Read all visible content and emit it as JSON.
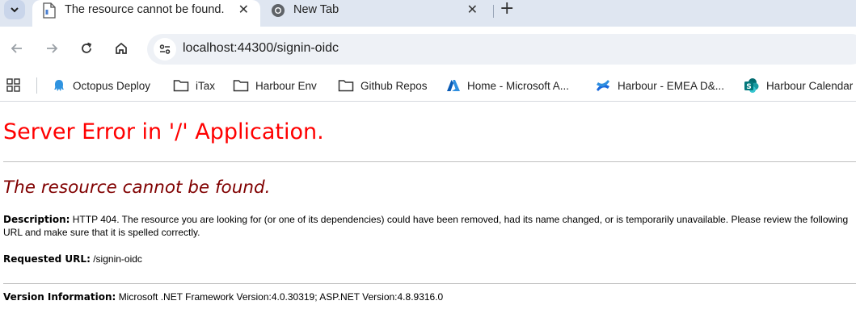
{
  "tabs": [
    {
      "title": "The resource cannot be found.",
      "active": true
    },
    {
      "title": "New Tab",
      "active": false
    }
  ],
  "newtab_label": "+",
  "close_glyph": "✕",
  "omnibox": {
    "url": "localhost:44300/signin-oidc"
  },
  "bookmarks": [
    {
      "label": "Octopus Deploy",
      "icon": "octopus-icon"
    },
    {
      "label": "iTax",
      "icon": "folder-icon"
    },
    {
      "label": "Harbour Env",
      "icon": "folder-icon"
    },
    {
      "label": "Github Repos",
      "icon": "folder-icon"
    },
    {
      "label": "Home - Microsoft A...",
      "icon": "azure-icon"
    },
    {
      "label": "Harbour - EMEA D&...",
      "icon": "confluence-icon"
    },
    {
      "label": "Harbour Calendar",
      "icon": "sharepoint-icon"
    }
  ],
  "error": {
    "heading": "Server Error in '/' Application.",
    "subheading": "The resource cannot be found.",
    "description_label": "Description:",
    "description_text": "HTTP 404. The resource you are looking for (or one of its dependencies) could have been removed, had its name changed, or is temporarily unavailable.  Please review the following URL and make sure that it is spelled correctly.",
    "requested_label": "Requested URL:",
    "requested_value": "/signin-oidc",
    "version_label": "Version Information:",
    "version_value": "Microsoft .NET Framework Version:4.0.30319; ASP.NET Version:4.8.9316.0"
  },
  "colors": {
    "heading": "#ff0000",
    "subheading": "#800000",
    "tabstrip": "#dfe6f1"
  }
}
